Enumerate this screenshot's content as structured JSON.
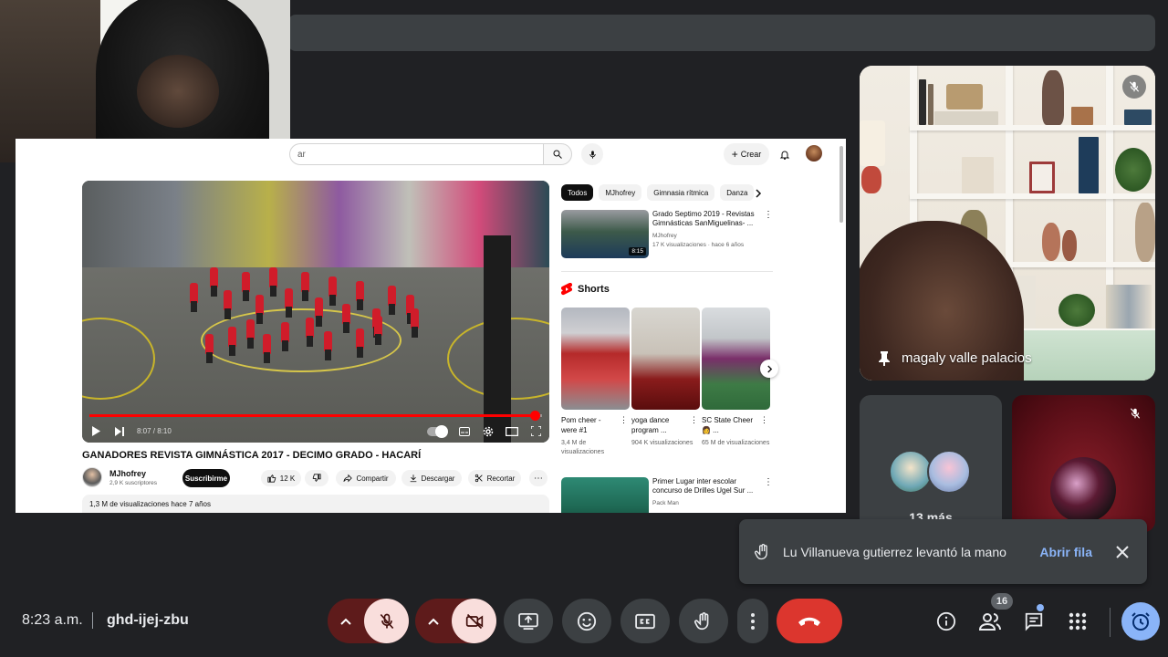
{
  "youtube": {
    "search_placeholder": "ar",
    "create_label": "Crear",
    "player": {
      "time": "8:07 / 8:10",
      "progress": 0.985
    },
    "video_title": "GANADORES REVISTA GIMNÁSTICA 2017 - DECIMO GRADO - HACARÍ",
    "channel_name": "MJhofrey",
    "channel_subs": "2,9 K suscriptores",
    "subscribe_label": "Suscribirme",
    "likes": "12 K",
    "share_label": "Compartir",
    "download_label": "Descargar",
    "clip_label": "Recortar",
    "description_meta": "1,3 M de visualizaciones  hace 7 años",
    "chips": [
      "Todos",
      "MJhofrey",
      "Gimnasia rítmica",
      "Danza"
    ],
    "recommended": [
      {
        "title": "Grado Septimo 2019 - Revistas Gimnásticas SanMiguelinas- ...",
        "channel": "MJhofrey",
        "meta": "17 K visualizaciones · hace 6 años",
        "duration": "8:15"
      },
      {
        "title": "Primer Lugar inter escolar concurso de Drilles Ugel Sur ...",
        "channel": "Pack Man",
        "meta": ""
      }
    ],
    "shorts_heading": "Shorts",
    "shorts": [
      {
        "title": "Pom cheer - were #1",
        "views": "3,4 M de visualizaciones"
      },
      {
        "title": "yoga dance program ...",
        "views": "904 K visualizaciones"
      },
      {
        "title": "SC State Cheer 👩 ...",
        "views": "65 M de visualizaciones"
      }
    ]
  },
  "participants": {
    "main_name": "magaly valle palacios",
    "more_label": "13 más"
  },
  "notification": {
    "text": "Lu Villanueva gutierrez levantó la mano",
    "action": "Abrir fila"
  },
  "meeting": {
    "time": "8:23 a.m.",
    "code": "ghd-ijej-zbu",
    "people_count": "16"
  },
  "colors": {
    "background": "#202124",
    "tile": "#3c4043",
    "end_call": "#dc362e",
    "accent": "#8ab4f8",
    "muted_button": "#f9dedc"
  }
}
